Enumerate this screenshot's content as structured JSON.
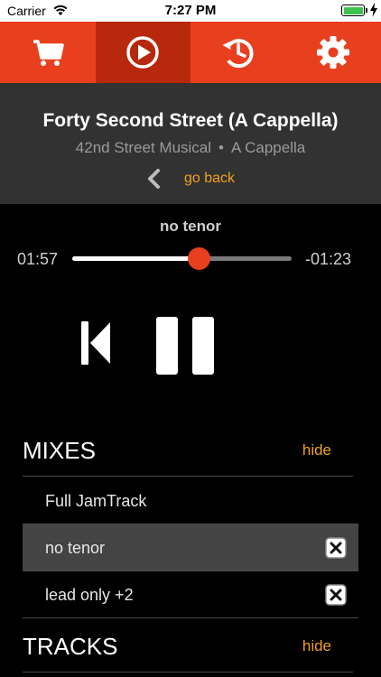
{
  "status": {
    "carrier": "Carrier",
    "time": "7:27 PM"
  },
  "tabs": [
    {
      "icon": "cart-icon",
      "active": false
    },
    {
      "icon": "play-circle-icon",
      "active": true
    },
    {
      "icon": "history-icon",
      "active": false
    },
    {
      "icon": "gear-icon",
      "active": false
    }
  ],
  "song": {
    "title": "Forty Second Street (A Cappella)",
    "musical": "42nd Street Musical",
    "separator": "•",
    "genre": "A Cappella",
    "back_label": "go back"
  },
  "player": {
    "mix_name": "no tenor",
    "elapsed": "01:57",
    "remaining": "-01:23",
    "progress": 0.58
  },
  "mixes": {
    "title": "MIXES",
    "hide_label": "hide",
    "items": [
      {
        "label": "Full JamTrack",
        "removable": false,
        "selected": false
      },
      {
        "label": "no tenor",
        "removable": true,
        "selected": true
      },
      {
        "label": "lead only +2",
        "removable": true,
        "selected": false
      }
    ]
  },
  "tracks": {
    "title": "TRACKS",
    "hide_label": "hide"
  },
  "colors": {
    "accent": "#e8401f",
    "accent_dark": "#b8280c",
    "link": "#f0a020"
  }
}
